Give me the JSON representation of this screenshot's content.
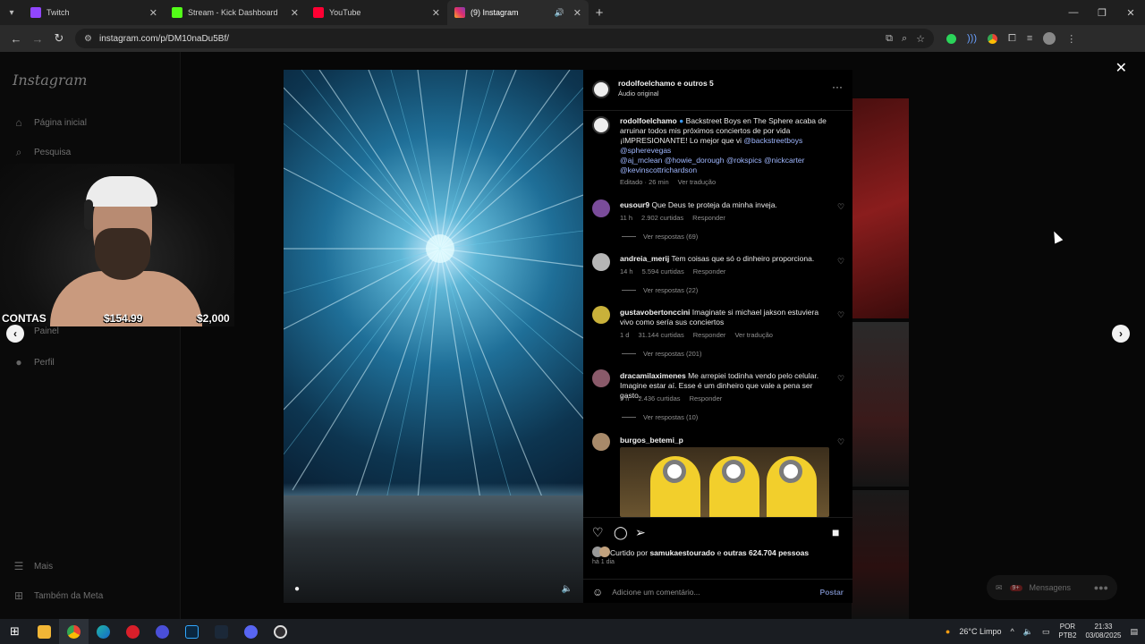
{
  "browser": {
    "tabs": [
      {
        "title": "Twitch",
        "color": "#9146ff",
        "active": false
      },
      {
        "title": "Stream - Kick Dashboard",
        "color": "#53fc18",
        "active": false
      },
      {
        "title": "YouTube",
        "color": "#ff0033",
        "active": false
      },
      {
        "title": "(9) Instagram",
        "color": "#e1306c",
        "active": true
      }
    ],
    "url": "instagram.com/p/DM10naDu5Bf/"
  },
  "sidebar": {
    "logo": "Instagram",
    "items": [
      "Página inicial",
      "Pesquisa",
      "Painel",
      "Perfil",
      "Mais",
      "Também da Meta"
    ]
  },
  "webcam_overlay": {
    "left": "CONTAS",
    "mid": "$154.99",
    "right": "$2,000"
  },
  "post": {
    "header_user": "rodolfoelchamo",
    "header_others": "e outros 5",
    "audio": "Áudio original",
    "caption_user": "rodolfoelchamo",
    "caption_text": "Backstreet Boys en The Sphere acaba de arruinar todos mis próximos conciertos de por vida ¡IMPRESIONANTE! Lo mejor que vi",
    "caption_mentions_1": "@backstreetboys",
    "caption_mentions_2": "@spherevegas",
    "caption_mentions_3": "@aj_mclean @howie_dorough @rokspics @nickcarter",
    "caption_mentions_4": "@kevinscottrichardson",
    "caption_meta": "Editado · 26 min",
    "see_translation": "Ver tradução"
  },
  "comments": [
    {
      "user": "eusour9",
      "text": "Que Deus te proteja da minha inveja.",
      "time": "11 h",
      "likes": "2.902 curtidas",
      "reply": "Responder",
      "replies": "Ver respostas (69)",
      "avatar": "#7a4c9a"
    },
    {
      "user": "andreia_merij",
      "text": "Tem coisas que só o dinheiro proporciona.",
      "time": "14 h",
      "likes": "5.594 curtidas",
      "reply": "Responder",
      "replies": "Ver respostas (22)",
      "avatar": "#b6b6b6"
    },
    {
      "user": "gustavobertonccini",
      "text": "Imaginate si michael jakson estuviera vivo como sería sus conciertos",
      "time": "1 d",
      "likes": "31.144 curtidas",
      "reply": "Responder",
      "translate": "Ver tradução",
      "replies": "Ver respostas (201)",
      "avatar": "#c9b13a"
    },
    {
      "user": "dracamilaximenes",
      "text": "Me arrepiei todinha vendo pelo celular. Imagine estar aí. Esse é um dinheiro que vale a pena ser gasto.",
      "time": "9 h",
      "likes": "2.436 curtidas",
      "reply": "Responder",
      "replies": "Ver respostas (10)",
      "avatar": "#8a5a6a"
    },
    {
      "user": "burgos_betemi_p",
      "avatar": "#a88a6a"
    }
  ],
  "footer": {
    "liked_prefix": "Curtido por",
    "liked_user": "samukaestourado",
    "liked_suffix": "e",
    "liked_others": "outras 624.704 pessoas",
    "date": "há 1 dia",
    "comment_placeholder": "Adicione um comentário...",
    "post_label": "Postar"
  },
  "messages_label": "Mensagens",
  "messages_badge": "9+",
  "taskbar": {
    "weather": "26°C  Limpo",
    "lang_1": "POR",
    "lang_2": "PTB2",
    "time": "21:33",
    "date": "03/08/2025"
  }
}
